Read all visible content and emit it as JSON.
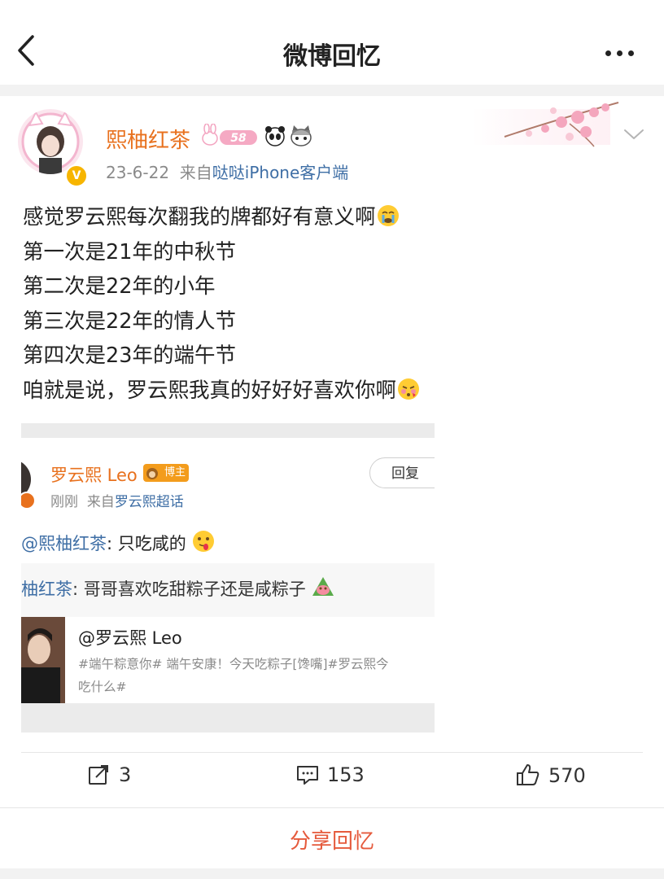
{
  "header": {
    "title": "微博回忆"
  },
  "post": {
    "author": "熙柚红茶",
    "level_badge": "58",
    "date": "23-6-22",
    "source_prefix": "来自",
    "source": "哒哒iPhone客户端",
    "lines": [
      "感觉罗云熙每次翻我的牌都好有意义啊",
      "第一次是21年的中秋节",
      "第二次是22年的小年",
      "第三次是22年的情人节",
      "第四次是23年的端午节",
      "咱就是说，罗云熙我真的好好好喜欢你啊"
    ]
  },
  "embed": {
    "username": "罗云熙 Leo",
    "tag": "博主",
    "time": "刚刚",
    "source_prefix": "来自",
    "source": "罗云熙超话",
    "reply_label": "回复",
    "comment_mention": "@熙柚红茶",
    "comment_text": ": 只吃咸的",
    "quote_mention": "柚红茶",
    "quote_text": ": 哥哥喜欢吃甜粽子还是咸粽子",
    "link_title": "@罗云熙 Leo",
    "link_desc": "#端午粽意你# 端午安康！今天吃粽子[馋嘴]#罗云熙今",
    "link_desc2": "吃什么#"
  },
  "actions": {
    "repost_count": "3",
    "comment_count": "153",
    "like_count": "570"
  },
  "share": {
    "label": "分享回忆"
  },
  "colors": {
    "username": "#e8711e",
    "link": "#3e6ea5",
    "share": "#e55a3c"
  }
}
